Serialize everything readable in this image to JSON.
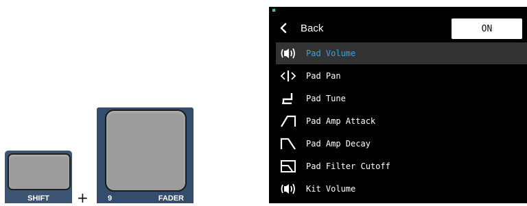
{
  "hardware": {
    "shift_label": "SHIFT",
    "plus_sign": "+",
    "fader_pad_number": "9",
    "fader_label": "FADER"
  },
  "screen": {
    "back_label": "Back",
    "toggle_label": "ON",
    "selected_color": "#36a4e0",
    "menu_items": [
      {
        "label": "Pad Volume",
        "icon": "speaker-icon",
        "selected": true
      },
      {
        "label": "Pad Pan",
        "icon": "pan-arrows-icon",
        "selected": false
      },
      {
        "label": "Pad Tune",
        "icon": "tune-step-icon",
        "selected": false
      },
      {
        "label": "Pad Amp Attack",
        "icon": "attack-envelope-icon",
        "selected": false
      },
      {
        "label": "Pad Amp Decay",
        "icon": "decay-envelope-icon",
        "selected": false
      },
      {
        "label": "Pad Filter Cutoff",
        "icon": "filter-cutoff-icon",
        "selected": false
      },
      {
        "label": "Kit Volume",
        "icon": "speaker-icon",
        "selected": false
      }
    ]
  }
}
